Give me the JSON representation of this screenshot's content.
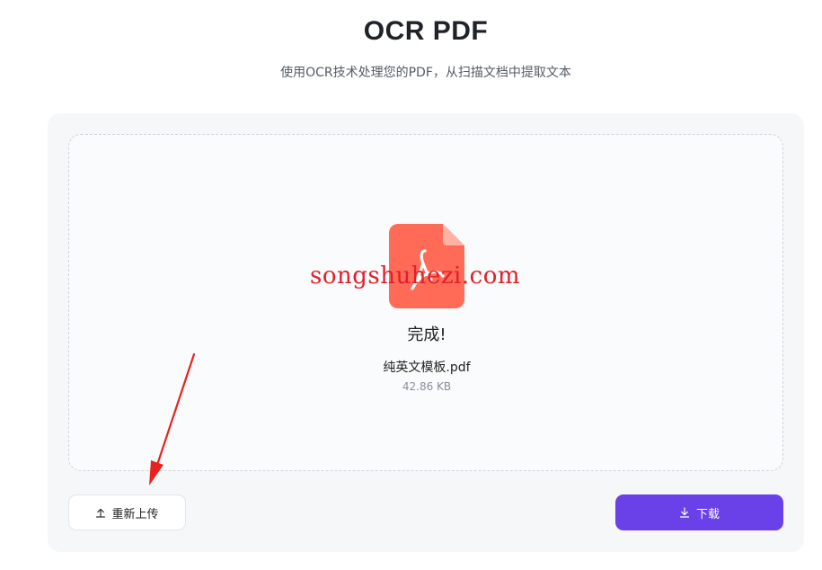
{
  "header": {
    "title": "OCR PDF",
    "subtitle": "使用OCR技术处理您的PDF，从扫描文档中提取文本"
  },
  "result": {
    "status": "完成!",
    "file_name": "纯英文模板.pdf",
    "file_size": "42.86 KB",
    "watermark": "songshuhezi.com"
  },
  "actions": {
    "reupload_label": "重新上传",
    "download_label": "下载"
  },
  "colors": {
    "accent": "#6a40e8",
    "pdf_icon": "#ff6b57",
    "annotation_arrow": "#e8231f"
  }
}
